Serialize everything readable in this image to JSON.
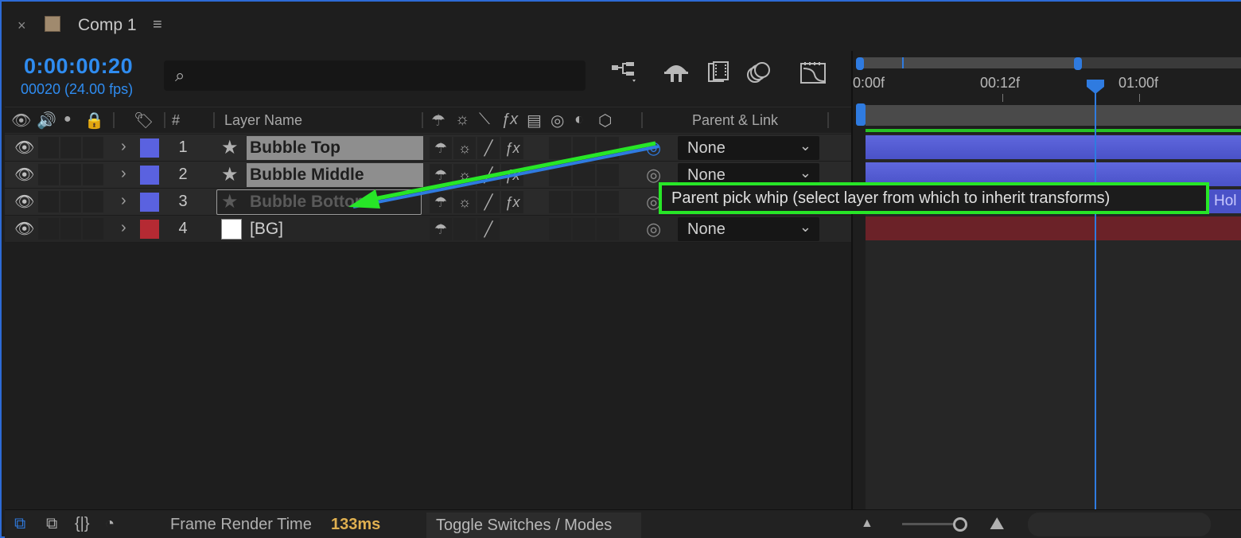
{
  "tab": {
    "close": "×",
    "title": "Comp 1",
    "menu": "≡"
  },
  "timecode": {
    "main": "0:00:00:20",
    "frames": "00020 (24.00 fps)"
  },
  "search": {
    "icon": "⌕",
    "placeholder": ""
  },
  "columns": {
    "hash": "#",
    "layer_name": "Layer Name",
    "parent_link": "Parent & Link"
  },
  "layers": [
    {
      "num": "1",
      "name": "Bubble Top",
      "label_color": "#5a62e0",
      "parent": "None"
    },
    {
      "num": "2",
      "name": "Bubble Middle",
      "label_color": "#5a62e0",
      "parent": "None"
    },
    {
      "num": "3",
      "name": "Bubble Bottom",
      "label_color": "#5a62e0",
      "parent": ""
    },
    {
      "num": "4",
      "name": "[BG]",
      "label_color": "#b52a33",
      "parent": "None"
    }
  ],
  "ruler": {
    "t0": "0:00f",
    "t1": "00:12f",
    "t2": "01:00f"
  },
  "track_text": "Hol",
  "tooltip": "Parent pick whip (select layer from which to inherit transforms)",
  "bottom": {
    "frt_label": "Frame Render Time",
    "frt_value": "133ms",
    "toggle": "Toggle Switches / Modes"
  },
  "colors": {
    "accent": "#2f8cf0",
    "highlight": "#27e627",
    "tooltip_border": "#27e627"
  }
}
